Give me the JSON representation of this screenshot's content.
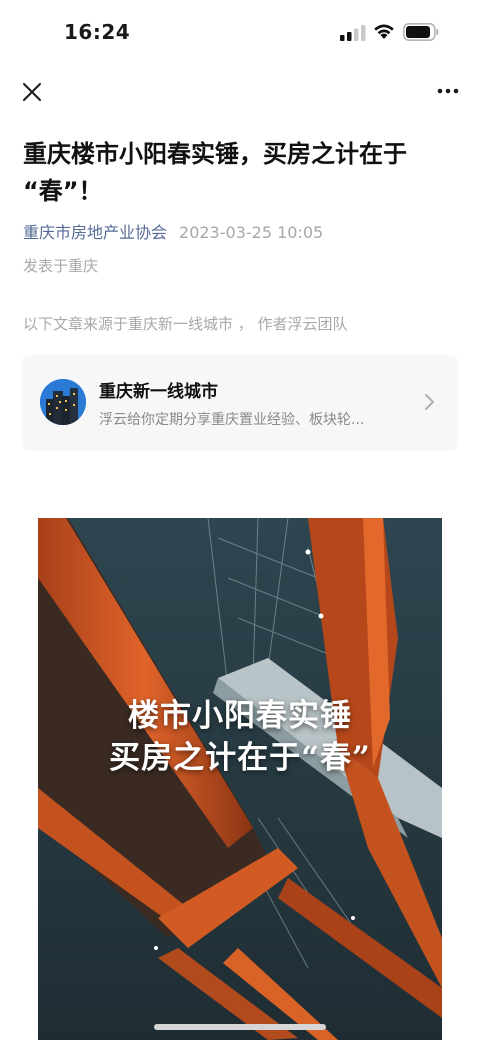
{
  "status_bar": {
    "time": "16:24",
    "icons": [
      "signal-icon",
      "wifi-icon",
      "battery-icon"
    ]
  },
  "nav": {
    "close_icon": "close-icon",
    "more_icon": "more-icon"
  },
  "article": {
    "title_line1": "重庆楼市小阳春实锤，买房之计在于",
    "title_line2": "“春”！",
    "account": "重庆市房地产业协会",
    "date": "2023-03-25 10:05",
    "location": "发表于重庆",
    "source_note": "以下文章来源于重庆新一线城市 ， 作者浮云团队"
  },
  "source_card": {
    "name": "重庆新一线城市",
    "description": "浮云给你定期分享重庆置业经验、板块轮...",
    "chevron_icon": "chevron-right-icon"
  },
  "cover_image": {
    "caption_line1": "楼市小阳春实锤",
    "caption_line2": "买房之计在于“春”"
  },
  "colors": {
    "link": "#576b95",
    "muted": "#a8a8a8",
    "card_bg": "#f7f7f7",
    "bridge_orange": "#d4561c"
  }
}
